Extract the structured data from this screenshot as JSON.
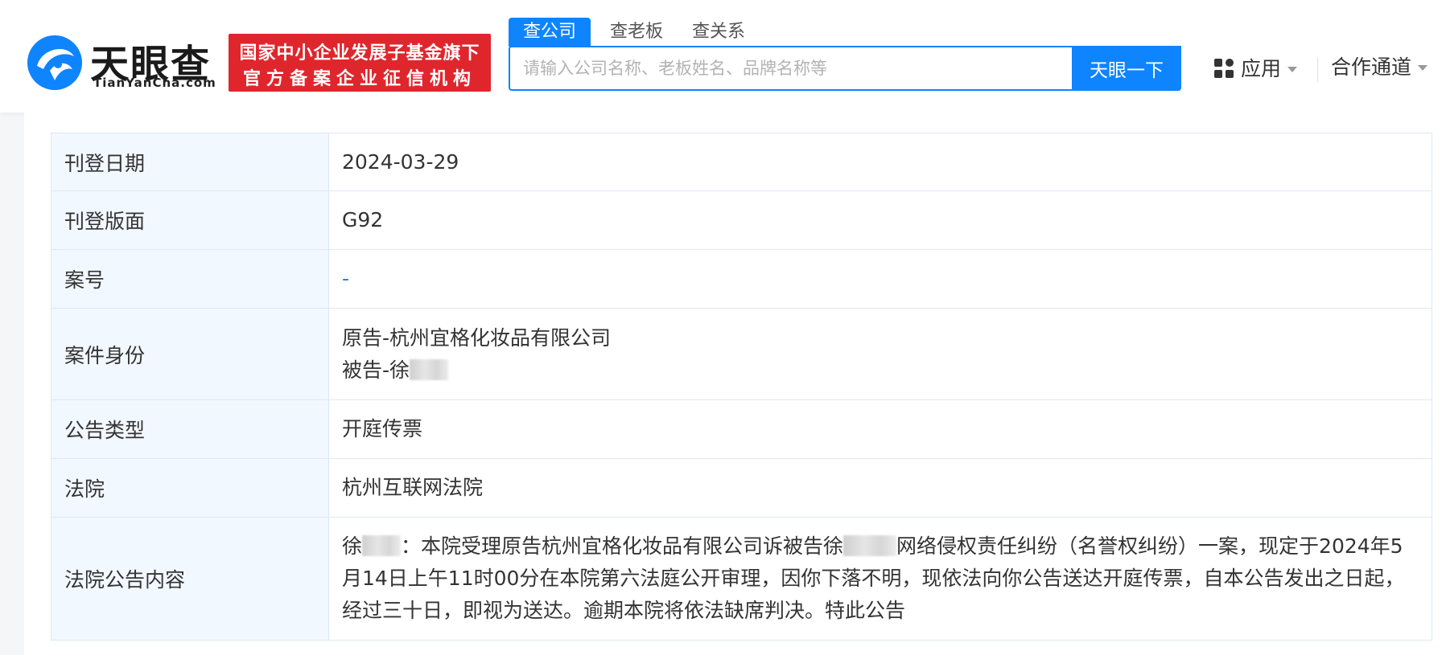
{
  "brand": {
    "name": "天眼查",
    "domain": "TianYanCha.com",
    "badge_line1": "国家中小企业发展子基金旗下",
    "badge_line2": "官方备案企业征信机构"
  },
  "search": {
    "tabs": [
      {
        "label": "查公司",
        "active": true
      },
      {
        "label": "查老板",
        "active": false
      },
      {
        "label": "查关系",
        "active": false
      }
    ],
    "placeholder": "请输入公司名称、老板姓名、品牌名称等",
    "button_label": "天眼一下"
  },
  "nav": {
    "apps_label": "应用",
    "coop_label": "合作通道"
  },
  "details": {
    "rows": [
      {
        "label": "刊登日期",
        "value": "2024-03-29"
      },
      {
        "label": "刊登版面",
        "value": "G92"
      },
      {
        "label": "案号",
        "value": "-"
      },
      {
        "label": "案件身份",
        "value_line1": "原告-杭州宜格化妆品有限公司",
        "value_line2_prefix": "被告-徐"
      },
      {
        "label": "公告类型",
        "value": "开庭传票"
      },
      {
        "label": "法院",
        "value": "杭州互联网法院"
      },
      {
        "label": "法院公告内容",
        "value_prefix": "徐",
        "value_mid": "：本院受理原告杭州宜格化妆品有限公司诉被告徐",
        "value_rest": "网络侵权责任纠纷（名誉权纠纷）一案，现定于2024年5月14日上午11时00分在本院第六法庭公开审理，因你下落不明，现依法向你公告送达开庭传票，自本公告发出之日起，经过三十日，即视为送达。逾期本院将依法缺席判决。特此公告"
      }
    ]
  },
  "colors": {
    "primary": "#0e84ff",
    "badge_red": "#e0262d",
    "label_bg": "#f2f8ff",
    "border": "#dce8f5"
  }
}
